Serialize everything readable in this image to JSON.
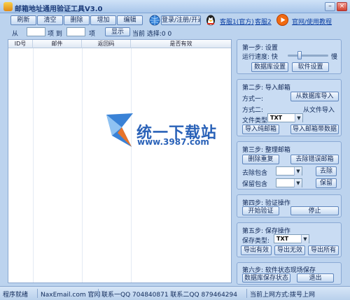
{
  "window": {
    "title": "邮箱地址通用验证工具V3.0",
    "minimize_glyph": "–",
    "close_glyph": "×"
  },
  "toolbar": {
    "buttons": [
      "刷新",
      "清空",
      "删除",
      "增加",
      "编辑"
    ],
    "register_label": "登录/注册/开通",
    "support_label": "客服1(官方)",
    "support2_label": "客服2",
    "tutorial_label": "官网/使用教程"
  },
  "filter": {
    "from_label": "从",
    "to_label": "项 到",
    "item_label": "项",
    "show_label": "显示",
    "current_label": "当前 选择:0 0"
  },
  "grid": {
    "columns": [
      "ID号",
      "邮件",
      "返回码",
      "是否有效"
    ]
  },
  "steps": {
    "step1": {
      "title": "第一步: 设置",
      "speed_label": "运行速度: 快",
      "slow_label": "慢",
      "speed_level": 0.3,
      "db_settings": "数据库设置",
      "sw_settings": "软件设置"
    },
    "step2": {
      "title": "第二步: 导入邮箱",
      "mode1_label": "方式一:",
      "mode1_button": "从数据库导入",
      "mode2_label": "方式二:",
      "mode2_text": "从文件导入",
      "filetype_label": "文件类型:",
      "filetype_value": "TXT",
      "import_pure": "导入纯邮箱",
      "import_with_data": "导入邮箱带数据"
    },
    "step3": {
      "title": "第三步: 整理邮箱",
      "dedupe": "删除重复",
      "remove_wrong": "去除错误邮箱",
      "remove_contains_label": "去除包含",
      "remove_button": "去除",
      "keep_contains_label": "保留包含",
      "keep_button": "保留"
    },
    "step4": {
      "title": "第四步: 验证操作",
      "start": "开始验证",
      "stop": "停止"
    },
    "step5": {
      "title": "第五步: 保存操作",
      "savetype_label": "保存类型:",
      "savetype_value": "TXT",
      "export_valid": "导出有效",
      "export_invalid": "导出无效",
      "export_all": "导出所有"
    },
    "step6": {
      "title": "第六步: 软件状态现场保存",
      "save_state": "数据库保存状态",
      "exit": "退出"
    }
  },
  "status": {
    "ready": "程序就绪",
    "site": "NaxEmail.com 官网",
    "contact": "联系一QQ 704840871 联系二QQ 879464294",
    "online": "当前上网方式:拨号上网"
  },
  "watermark": {
    "text": "统一下载站",
    "url": "www.3987.com"
  },
  "colors": {
    "background": "#bcd3ee",
    "accent": "#2a62b8"
  }
}
